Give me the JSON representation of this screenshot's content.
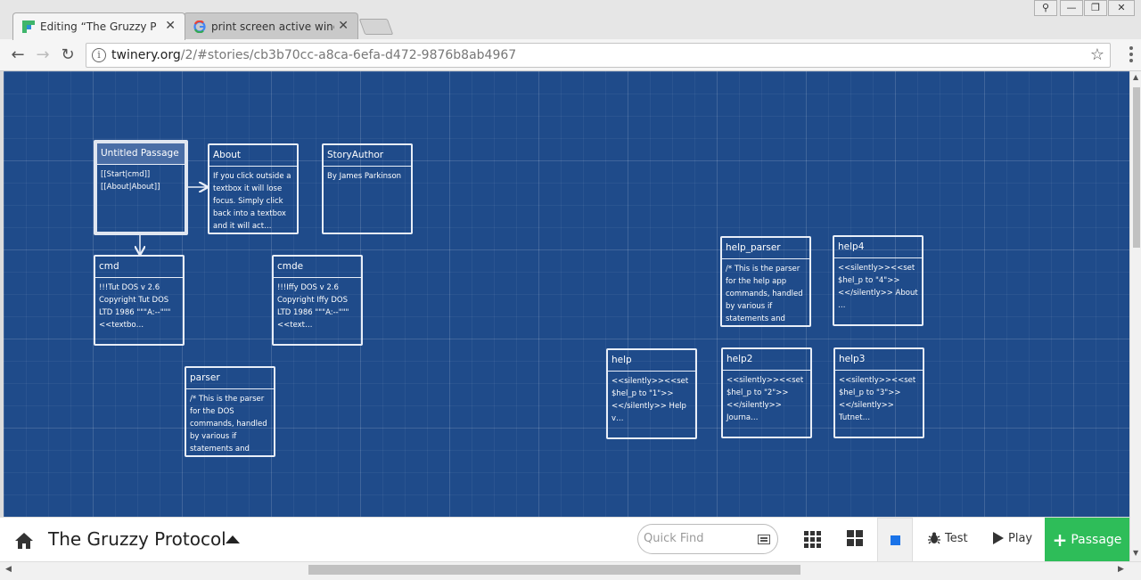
{
  "browser": {
    "tabs": [
      {
        "title": "Editing “The Gruzzy Protoc",
        "active": true,
        "icon": "twine-favicon"
      },
      {
        "title": "print screen active window",
        "active": false,
        "icon": "google-favicon"
      }
    ],
    "url_host": "twinery.org",
    "url_path": "/2/#stories/cb3b70cc-a8ca-6efa-d472-9876b8ab4967"
  },
  "passages": [
    {
      "id": "untitled",
      "title": "Untitled Passage",
      "excerpt": "[[Start|cmd]]\n[[About|About]]",
      "selected": true
    },
    {
      "id": "about",
      "title": "About",
      "excerpt": "If you click outside a textbox it will lose focus. Simply click back into a textbox and it will act…"
    },
    {
      "id": "storyauthor",
      "title": "StoryAuthor",
      "excerpt": "By James Parkinson"
    },
    {
      "id": "cmd",
      "title": "cmd",
      "excerpt": "!!!Tut DOS v 2.6\nCopyright Tut DOS LTD 1986 \"\"\"A:--\"\"\"\n<<textbo…"
    },
    {
      "id": "cmde",
      "title": "cmde",
      "excerpt": "!!!Iffy DOS v 2.6\nCopyright Iffy DOS LTD 1986 \"\"\"A:--\"\"\"\n<<text…"
    },
    {
      "id": "parser",
      "title": "parser",
      "excerpt": "/* This is the parser for the DOS commands, handled by various if statements and"
    },
    {
      "id": "help_parser",
      "title": "help_parser",
      "excerpt": "/* This is the parser for the help app commands, handled by various if statements and"
    },
    {
      "id": "help4",
      "title": "help4",
      "excerpt": "<<silently>><<set $hel_p to \"4\">> <</silently>> About …"
    },
    {
      "id": "help",
      "title": "help",
      "excerpt": "<<silently>><<set $hel_p to \"1\">> <</silently>> Help v…"
    },
    {
      "id": "help2",
      "title": "help2",
      "excerpt": "<<silently>><<set $hel_p to \"2\">> <</silently>> Journa…"
    },
    {
      "id": "help3",
      "title": "help3",
      "excerpt": "<<silently>><<set $hel_p to \"3\">> <</silently>> Tutnet…"
    }
  ],
  "toolbar": {
    "story_name": "The Gruzzy Protocol",
    "quick_find_placeholder": "Quick Find",
    "test_label": "Test",
    "play_label": "Play",
    "passage_label": "Passage"
  },
  "colors": {
    "map_background": "#1f4b8a",
    "passage_button": "#2ebd59",
    "active_zoom_indicator": "#1a73e8"
  }
}
